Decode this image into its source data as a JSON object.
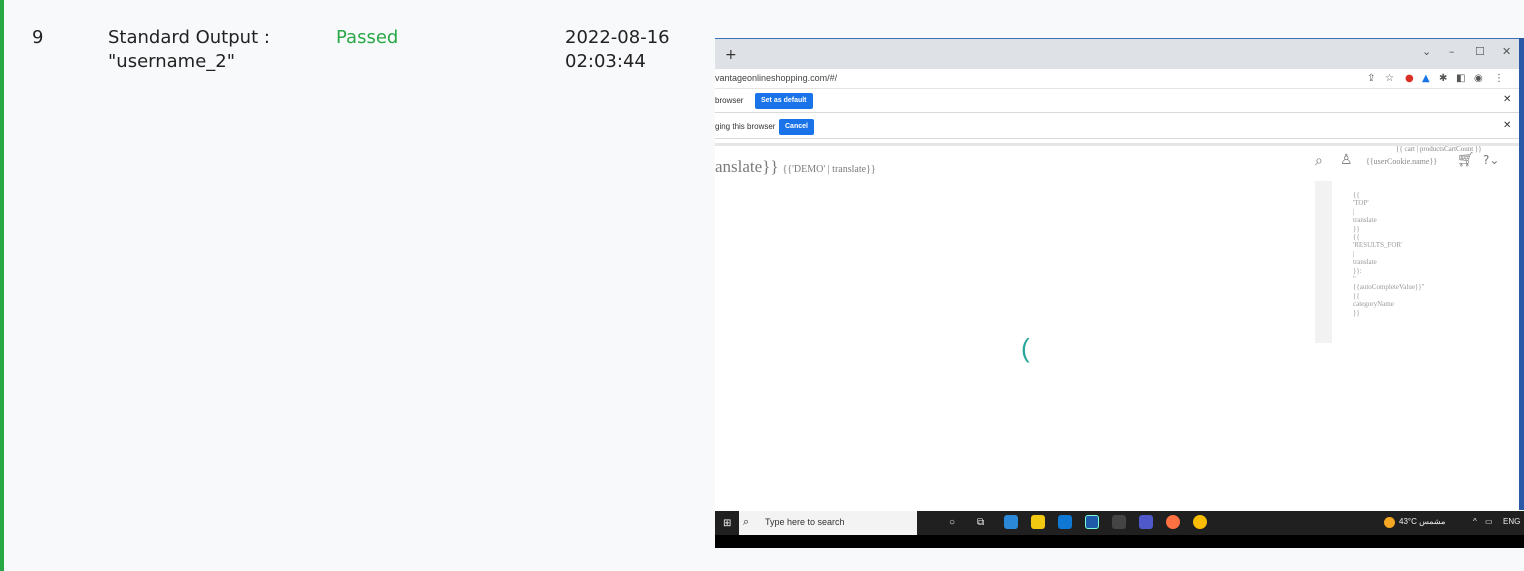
{
  "row": {
    "number": "9",
    "step_line1": "Standard Output :",
    "step_line2": "\"username_2\"",
    "status": "Passed",
    "date": "2022-08-16",
    "time": "02:03:44"
  },
  "screenshot": {
    "tab_new": "+",
    "window_controls": [
      "⌄",
      "–",
      "☐",
      "✕"
    ],
    "url": "vantageonlineshopping.com/#/",
    "toolbar_icons": [
      "share-icon",
      "star-icon",
      "extension-icon",
      "drive-icon",
      "puzzle-icon",
      "sidebar-icon",
      "profile-icon",
      "menu-icon"
    ],
    "infobar1": {
      "text": "browser",
      "button": "Set as default",
      "close": "✕"
    },
    "infobar2": {
      "text": "ging this browser",
      "button": "Cancel",
      "close": "✕"
    },
    "logo_big": "anslate}}",
    "logo_small": "{{'DEMO' | translate}}",
    "cart_count": "{{ cart | productsCartCount }}",
    "user_name": "{{userCookie.name}}",
    "dropdown_lines": [
      "{{",
      "'TOP'",
      "|",
      "translate",
      "}}",
      "{{",
      "'RESULTS_FOR'",
      "|",
      "translate",
      "}}:",
      "\"",
      "{{autoCompleteValue}}\"",
      "{{",
      "categoryName",
      "}}"
    ],
    "spinner": "(",
    "taskbar": {
      "search_placeholder": "Type here to search",
      "weather": "43°C مشمس",
      "lang": "ENG"
    }
  },
  "colors": {
    "passed": "#28a745",
    "accent": "#28a745",
    "button": "#1a73e8",
    "spinner": "#2aa59a"
  }
}
